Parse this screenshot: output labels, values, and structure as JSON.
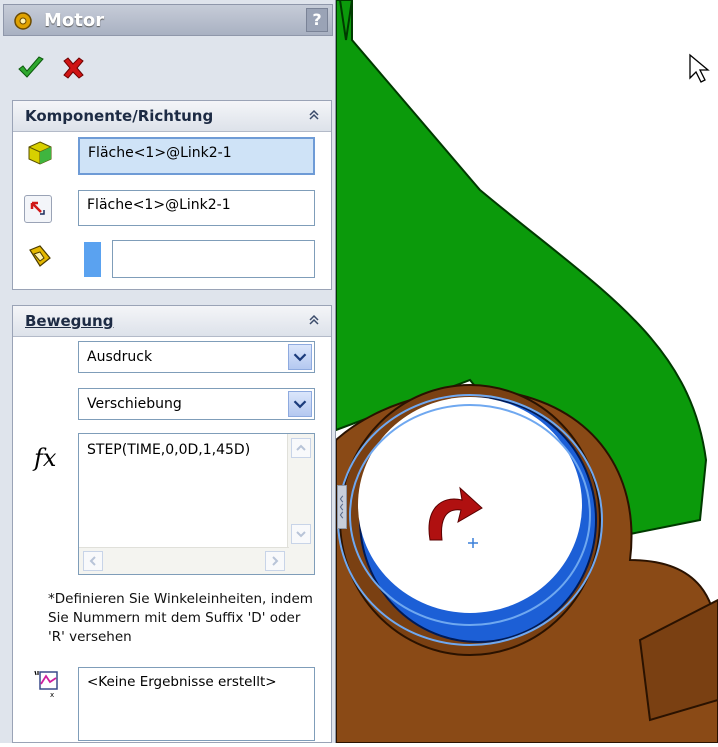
{
  "panel": {
    "title": "Motor",
    "help_label": "?",
    "sections": {
      "komponente": {
        "title": "Komponente/Richtung",
        "component_value": "Fläche<1>@Link2-1",
        "direction_value": "Fläche<1>@Link2-1",
        "relative_value": ""
      },
      "bewegung": {
        "title": "Bewegung",
        "type_value": "Ausdruck",
        "mode_value": "Verschiebung",
        "expression": "STEP(TIME,0,0D,1,45D)",
        "fx_label": "fx",
        "hint": "*Definieren Sie Winkeleinheiten, indem Sie Nummern mit dem Suffix 'D' oder 'R' versehen",
        "results": "<Keine Ergebnisse erstellt>"
      }
    }
  },
  "colors": {
    "green_part": "#0b9a0b",
    "brown_part": "#8a4a16",
    "blue_face": "#1c5fd6",
    "arrow_red": "#b01010",
    "accent_blue": "#5aa2f0"
  },
  "icons": {
    "title": "motor-icon",
    "ok": "check-icon",
    "cancel": "x-icon",
    "component": "cube-icon",
    "direction": "direction-arrow-icon",
    "relative": "relative-part-icon",
    "expression": "fx-icon",
    "results": "graph-icon",
    "cursor": "mouse-cursor-icon",
    "rotation": "rotation-arrow-icon"
  }
}
